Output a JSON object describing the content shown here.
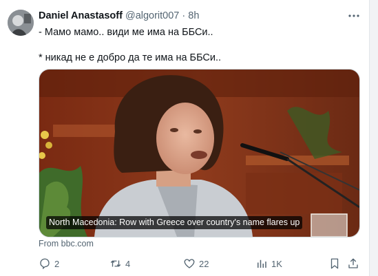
{
  "tweet": {
    "author_name": "Daniel Anastasoff",
    "handle": "@algorit007",
    "separator": "·",
    "time": "8h",
    "more_icon": "more-icon",
    "text_line1": "- Мамо мамо.. види ме има на ББСи..",
    "text_line2": "* никад не е добро да те има на ББСи..",
    "card": {
      "headline": "North Macedonia: Row with Greece over country's name flares up",
      "source": "From bbc.com"
    },
    "actions": {
      "replies": "2",
      "reposts": "4",
      "likes": "22",
      "views": "1K"
    }
  }
}
